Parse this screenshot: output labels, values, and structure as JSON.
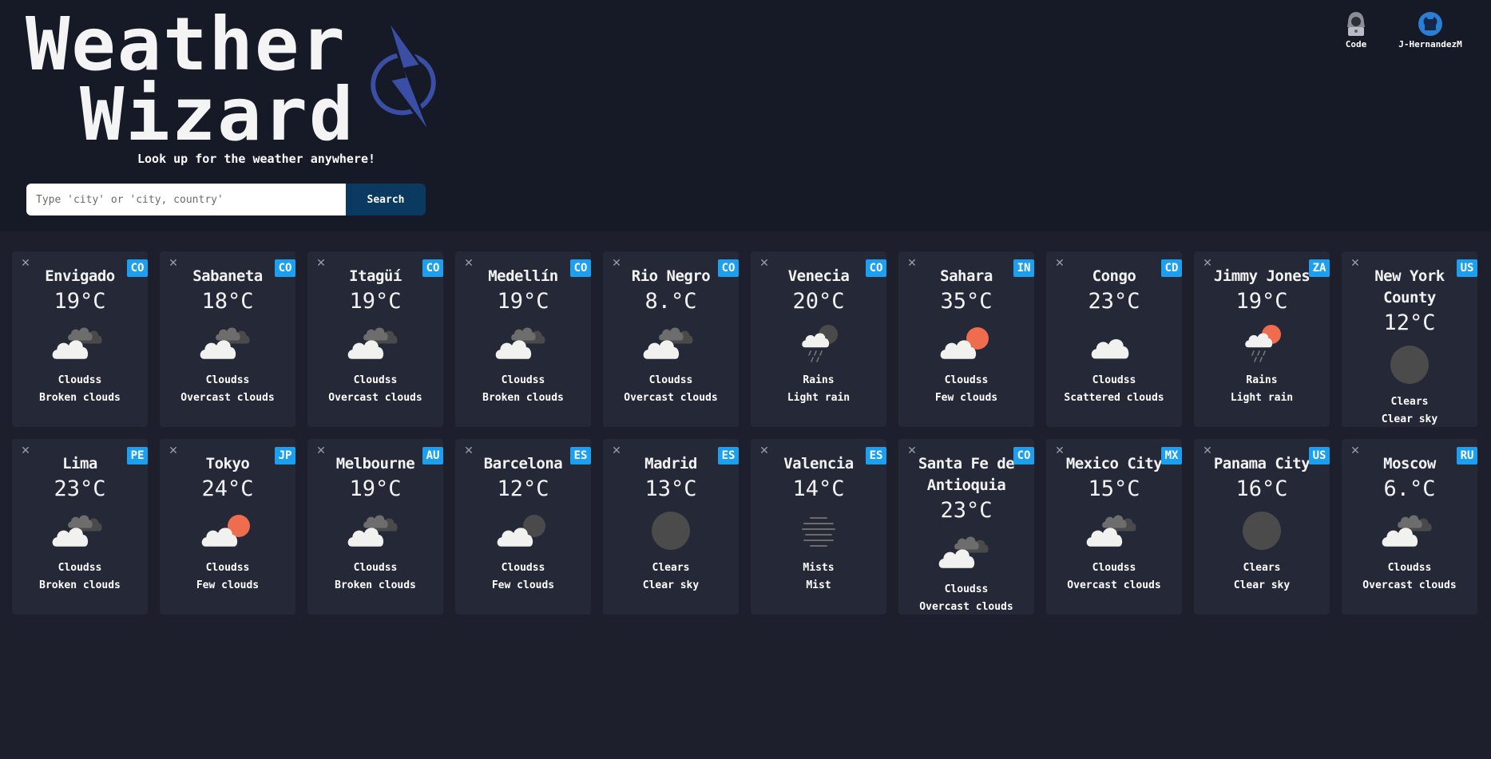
{
  "header": {
    "title_line1": "Weather",
    "title_line2": "Wizard",
    "subtitle": "Look up for the weather anywhere!",
    "links": [
      {
        "label": "Code",
        "icon": "hacker-avatar-icon"
      },
      {
        "label": "J-HernandezM",
        "icon": "github-icon"
      }
    ]
  },
  "search": {
    "placeholder": "Type 'city' or 'city, country'",
    "value": "",
    "button_label": "Search"
  },
  "colors": {
    "background": "#1d1f2d",
    "header_background": "#161926",
    "card_background": "#252837",
    "badge": "#1d9ff0",
    "search_button": "#0b3a61",
    "logo_bolt": "#3b4ea6",
    "sun": "#ef6c4e"
  },
  "cards": [
    {
      "city": "Envigado",
      "country": "CO",
      "temp": "19°C",
      "main": "Cloudss",
      "desc": "Broken clouds",
      "icon": "broken-clouds-icon",
      "close": "✕"
    },
    {
      "city": "Sabaneta",
      "country": "CO",
      "temp": "18°C",
      "main": "Cloudss",
      "desc": "Overcast clouds",
      "icon": "broken-clouds-icon",
      "close": "✕"
    },
    {
      "city": "Itagüí",
      "country": "CO",
      "temp": "19°C",
      "main": "Cloudss",
      "desc": "Overcast clouds",
      "icon": "broken-clouds-icon",
      "close": "✕"
    },
    {
      "city": "Medellín",
      "country": "CO",
      "temp": "19°C",
      "main": "Cloudss",
      "desc": "Broken clouds",
      "icon": "broken-clouds-icon",
      "close": "✕"
    },
    {
      "city": "Rio Negro",
      "country": "CO",
      "temp": "8.°C",
      "main": "Cloudss",
      "desc": "Overcast clouds",
      "icon": "broken-clouds-icon",
      "close": "✕"
    },
    {
      "city": "Venecia",
      "country": "CO",
      "temp": "20°C",
      "main": "Rains",
      "desc": "Light rain",
      "icon": "rain-night-icon",
      "close": "✕"
    },
    {
      "city": "Sahara",
      "country": "IN",
      "temp": "35°C",
      "main": "Cloudss",
      "desc": "Few clouds",
      "icon": "few-clouds-day-icon",
      "close": "✕"
    },
    {
      "city": "Congo",
      "country": "CD",
      "temp": "23°C",
      "main": "Cloudss",
      "desc": "Scattered clouds",
      "icon": "scattered-clouds-icon",
      "close": "✕"
    },
    {
      "city": "Jimmy Jones",
      "country": "ZA",
      "temp": "19°C",
      "main": "Rains",
      "desc": "Light rain",
      "icon": "rain-day-icon",
      "close": "✕"
    },
    {
      "city": "New York County",
      "country": "US",
      "temp": "12°C",
      "main": "Clears",
      "desc": "Clear sky",
      "icon": "clear-night-icon",
      "close": "✕"
    },
    {
      "city": "Lima",
      "country": "PE",
      "temp": "23°C",
      "main": "Cloudss",
      "desc": "Broken clouds",
      "icon": "broken-clouds-icon",
      "close": "✕"
    },
    {
      "city": "Tokyo",
      "country": "JP",
      "temp": "24°C",
      "main": "Cloudss",
      "desc": "Few clouds",
      "icon": "few-clouds-day-icon",
      "close": "✕"
    },
    {
      "city": "Melbourne",
      "country": "AU",
      "temp": "19°C",
      "main": "Cloudss",
      "desc": "Broken clouds",
      "icon": "broken-clouds-icon",
      "close": "✕"
    },
    {
      "city": "Barcelona",
      "country": "ES",
      "temp": "12°C",
      "main": "Cloudss",
      "desc": "Few clouds",
      "icon": "few-clouds-night-icon",
      "close": "✕"
    },
    {
      "city": "Madrid",
      "country": "ES",
      "temp": "13°C",
      "main": "Clears",
      "desc": "Clear sky",
      "icon": "clear-night-icon",
      "close": "✕"
    },
    {
      "city": "Valencia",
      "country": "ES",
      "temp": "14°C",
      "main": "Mists",
      "desc": "Mist",
      "icon": "mist-icon",
      "close": "✕"
    },
    {
      "city": "Santa Fe de Antioquia",
      "country": "CO",
      "temp": "23°C",
      "main": "Cloudss",
      "desc": "Overcast clouds",
      "icon": "broken-clouds-icon",
      "close": "✕"
    },
    {
      "city": "Mexico City",
      "country": "MX",
      "temp": "15°C",
      "main": "Cloudss",
      "desc": "Overcast clouds",
      "icon": "broken-clouds-icon",
      "close": "✕"
    },
    {
      "city": "Panama City",
      "country": "US",
      "temp": "16°C",
      "main": "Clears",
      "desc": "Clear sky",
      "icon": "clear-night-icon",
      "close": "✕"
    },
    {
      "city": "Moscow",
      "country": "RU",
      "temp": "6.°C",
      "main": "Cloudss",
      "desc": "Overcast clouds",
      "icon": "broken-clouds-icon",
      "close": "✕"
    }
  ]
}
